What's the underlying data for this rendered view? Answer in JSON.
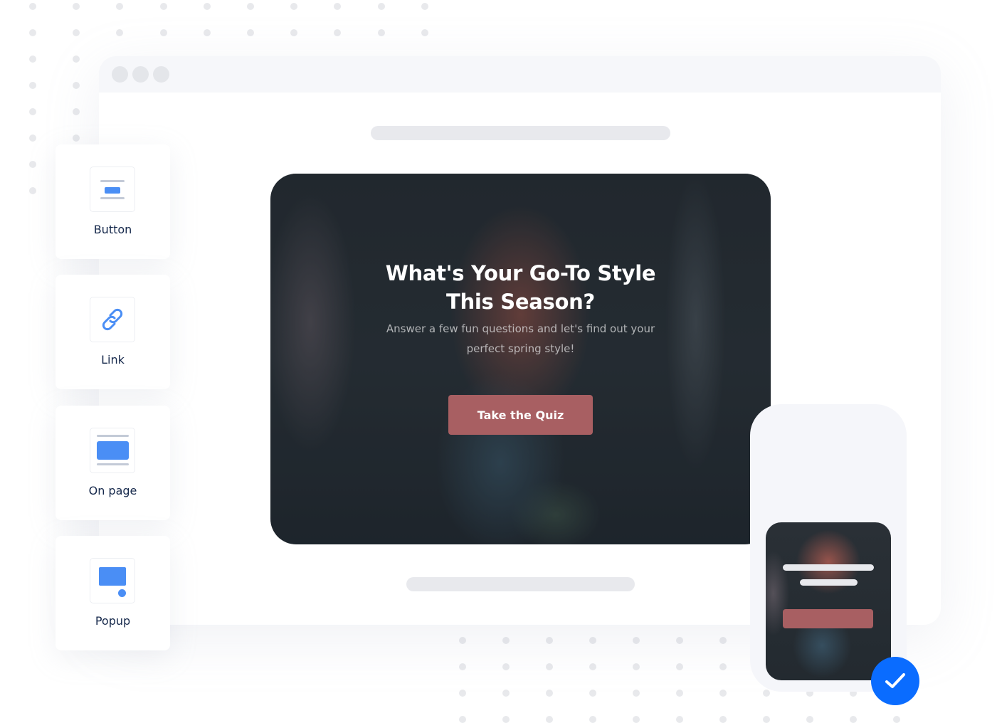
{
  "browser": {
    "window_controls": [
      "close-dot",
      "minimize-dot",
      "maximize-dot"
    ]
  },
  "hero": {
    "title": "What's Your Go-To Style This Season?",
    "subtitle": "Answer a few fun questions and let's find out your perfect spring style!",
    "cta_label": "Take the Quiz",
    "cta_color": "#a85f62"
  },
  "display_options": [
    {
      "label": "Button",
      "icon": "button-icon"
    },
    {
      "label": "Link",
      "icon": "link-icon"
    },
    {
      "label": "On page",
      "icon": "on-page-icon"
    },
    {
      "label": "Popup",
      "icon": "popup-icon"
    }
  ],
  "colors": {
    "accent_blue": "#4a8ef5",
    "check_blue": "#0a6cff",
    "label_navy": "#15284b"
  },
  "mobile_preview": {
    "status_icon": "check-icon"
  }
}
